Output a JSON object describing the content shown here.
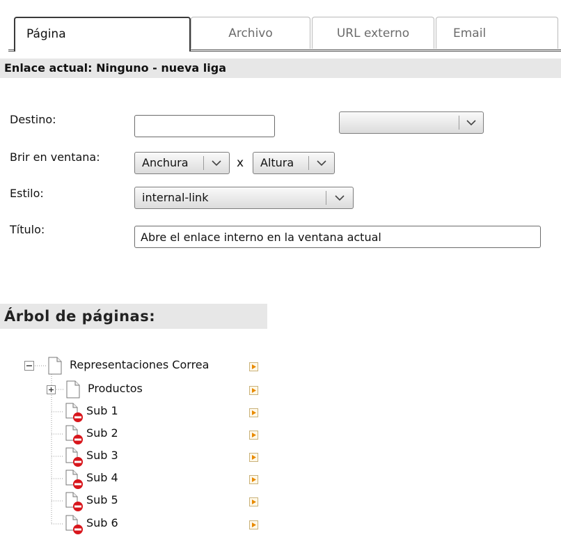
{
  "tabs": [
    {
      "label": "Página",
      "active": true
    },
    {
      "label": "Archivo",
      "active": false
    },
    {
      "label": "URL externo",
      "active": false
    },
    {
      "label": "Email",
      "active": false
    }
  ],
  "current_link": "Enlace actual: Ninguno - nueva liga",
  "form": {
    "destino_label": "Destino:",
    "destino_value": "",
    "destino_select_value": "",
    "ventana_label": "Brir en ventana:",
    "anchura": "Anchura",
    "x": "x",
    "altura": "Altura",
    "estilo_label": "Estilo:",
    "estilo_value": "internal-link",
    "titulo_label": "Título:",
    "titulo_value": "Abre el enlace interno en la ventana actual"
  },
  "tree": {
    "title": "Árbol de páginas:",
    "root": "Representaciones Correa",
    "items": [
      "Productos",
      "Sub 1",
      "Sub 2",
      "Sub 3",
      "Sub 4",
      "Sub 5",
      "Sub 6"
    ]
  },
  "colors": {
    "header_bg": "#e7e7e7",
    "arrow_orange": "#e88a00",
    "restricted_red": "#d8161c"
  },
  "icons": [
    "collapse-icon",
    "expand-icon",
    "page-icon",
    "restricted-page-icon",
    "chevron-down-icon",
    "link-arrow-icon"
  ]
}
